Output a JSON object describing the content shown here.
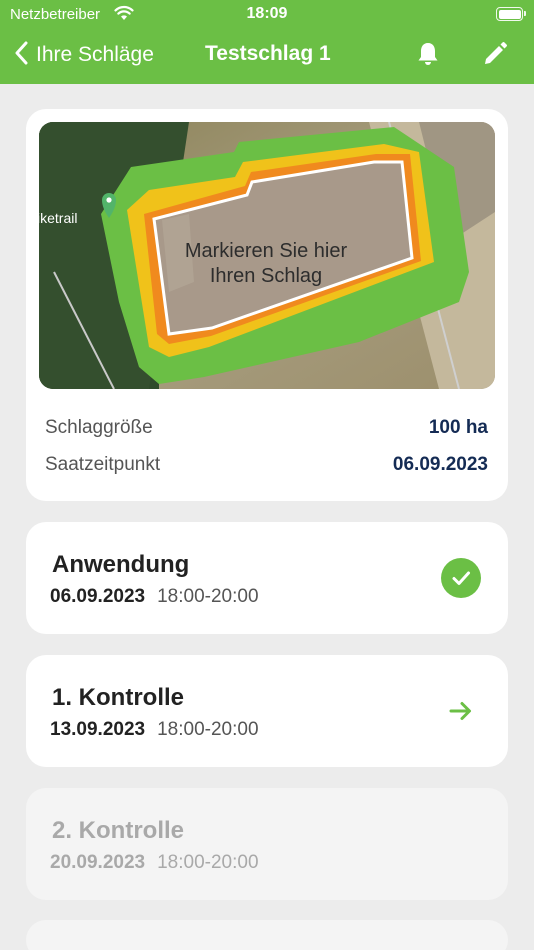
{
  "status_bar": {
    "carrier": "Netzbetreiber",
    "time": "18:09"
  },
  "nav": {
    "back_label": "Ihre Schläge",
    "title": "Testschlag 1"
  },
  "field": {
    "map_label_line1": "Markieren Sie hier",
    "map_label_line2": "Ihren Schlag",
    "map_poi_label": "iketrail",
    "size_label": "Schlaggröße",
    "size_value": "100 ha",
    "sowing_label": "Saatzeitpunkt",
    "sowing_value": "06.09.2023"
  },
  "steps": [
    {
      "title": "Anwendung",
      "date": "06.09.2023",
      "time": "18:00-20:00",
      "state": "done"
    },
    {
      "title": "1. Kontrolle",
      "date": "13.09.2023",
      "time": "18:00-20:00",
      "state": "next"
    },
    {
      "title": "2. Kontrolle",
      "date": "20.09.2023",
      "time": "18:00-20:00",
      "state": "disabled"
    }
  ],
  "colors": {
    "brand_green": "#6bbf45",
    "value_navy": "#142b54",
    "buffer_yellow": "#f0c21a",
    "border_orange": "#f08a1e"
  },
  "icons": [
    "wifi-icon",
    "battery-icon",
    "chevron-left-icon",
    "bell-icon",
    "pencil-icon",
    "map-pin-icon",
    "check-icon",
    "arrow-right-icon"
  ]
}
